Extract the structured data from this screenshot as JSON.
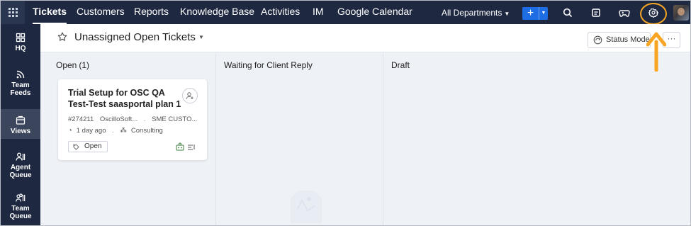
{
  "topbar": {
    "tabs": [
      {
        "label": "Tickets",
        "active": true
      },
      {
        "label": "Customers"
      },
      {
        "label": "Reports"
      },
      {
        "label": "Knowledge Base"
      },
      {
        "label": "Activities"
      },
      {
        "label": "IM"
      },
      {
        "label": "Google Calendar"
      }
    ],
    "department": "All Departments",
    "add_label": "+",
    "icons": [
      "search-icon",
      "notes-icon",
      "gamepad-icon",
      "gear-icon",
      "user-avatar"
    ]
  },
  "sidebar": {
    "items": [
      {
        "label": "HQ",
        "icon": "grid-icon"
      },
      {
        "label": "Team Feeds",
        "icon": "feed-icon"
      },
      {
        "label": "Views",
        "icon": "views-icon",
        "active": true
      },
      {
        "label": "Agent Queue",
        "icon": "agent-queue-icon"
      },
      {
        "label": "Team Queue",
        "icon": "team-queue-icon"
      }
    ]
  },
  "header": {
    "view_title": "Unassigned Open Tickets",
    "status_mode_label": "Status Mode",
    "more_label": "···"
  },
  "board": {
    "columns": [
      {
        "title": "Open",
        "count": "(1)"
      },
      {
        "title": "Waiting for Client Reply",
        "count": ""
      },
      {
        "title": "Draft",
        "count": ""
      }
    ],
    "card": {
      "subject": "Trial Setup for OSC QA Test-Test saasportal plan 1",
      "ticket_id": "#274211",
      "account": "OscilloSoft...",
      "contact": "SME CUSTO...",
      "age": "1 day ago",
      "classification": "Consulting",
      "status": "Open"
    }
  },
  "colors": {
    "nav_bg": "#1e2841",
    "accent_blue": "#1f6de4",
    "highlight_orange": "#f7a523",
    "board_bg": "#eef1f6"
  }
}
